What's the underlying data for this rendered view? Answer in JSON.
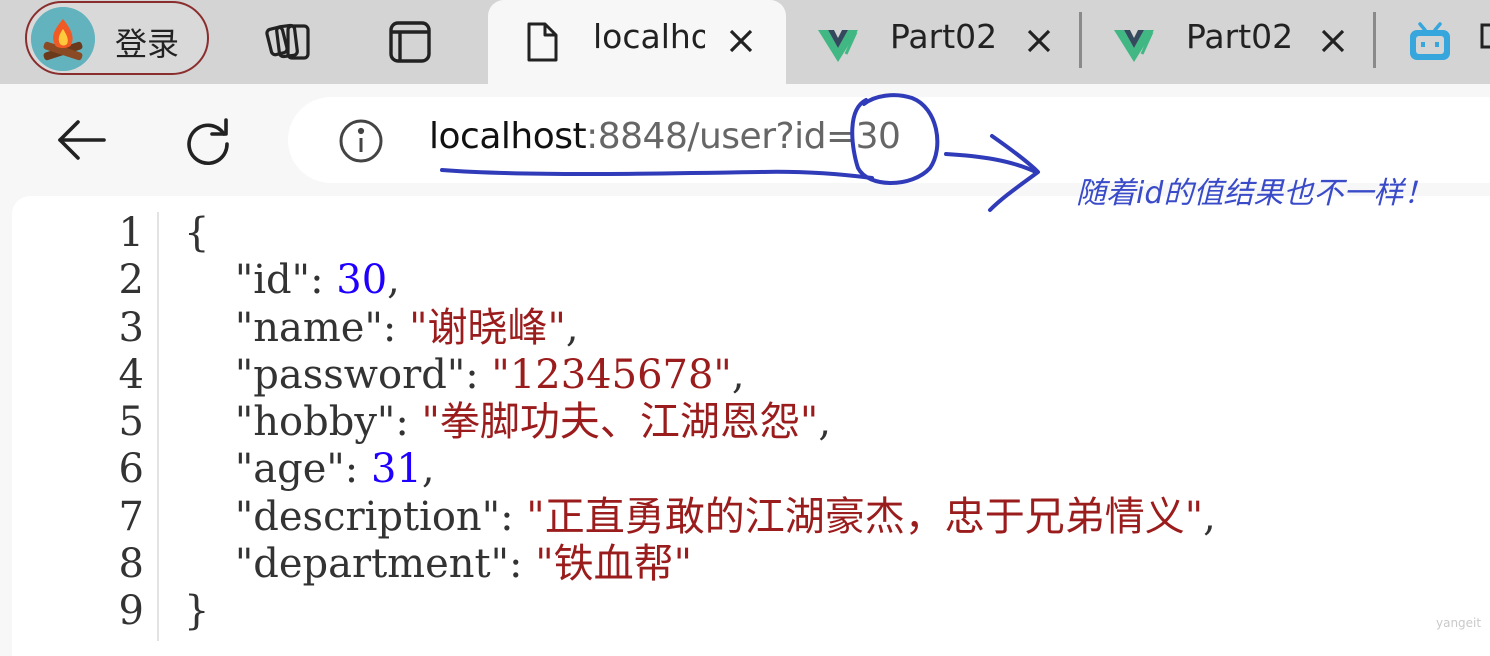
{
  "profile": {
    "label": "登录",
    "icon": "campfire-avatar-icon"
  },
  "tabs": [
    {
      "title": "localho",
      "icon": "document-icon",
      "active": true
    },
    {
      "title": "Part02",
      "icon": "vue-logo-icon",
      "active": false
    },
    {
      "title": "Part02",
      "icon": "vue-logo-icon",
      "active": false
    },
    {
      "title": "",
      "icon": "bilibili-tv-icon",
      "active": false
    }
  ],
  "toolbar": {
    "url_host": "localhost",
    "url_rest": ":8848/user?id=30"
  },
  "annotation": {
    "text": "随着id的值结果也不一样！",
    "color": "#3a4bc9"
  },
  "json_view": {
    "line_numbers": [
      "1",
      "2",
      "3",
      "4",
      "5",
      "6",
      "7",
      "8",
      "9"
    ],
    "open_brace": "{",
    "close_brace": "}",
    "fields": [
      {
        "key": "\"id\"",
        "value": "30",
        "type": "number",
        "comma": ","
      },
      {
        "key": "\"name\"",
        "value": "\"谢晓峰\"",
        "type": "string",
        "comma": ","
      },
      {
        "key": "\"password\"",
        "value": "\"12345678\"",
        "type": "string",
        "comma": ","
      },
      {
        "key": "\"hobby\"",
        "value": "\"拳脚功夫、江湖恩怨\"",
        "type": "string",
        "comma": ","
      },
      {
        "key": "\"age\"",
        "value": "31",
        "type": "number",
        "comma": ","
      },
      {
        "key": "\"description\"",
        "value": "\"正直勇敢的江湖豪杰，忠于兄弟情义\"",
        "type": "string",
        "comma": ","
      },
      {
        "key": "\"department\"",
        "value": "\"铁血帮\"",
        "type": "string",
        "comma": ""
      }
    ]
  },
  "watermark": "yangeit",
  "colors": {
    "number": "#1f00ff",
    "string": "#9b1c1c",
    "tabstrip": "#d4d4d4"
  }
}
